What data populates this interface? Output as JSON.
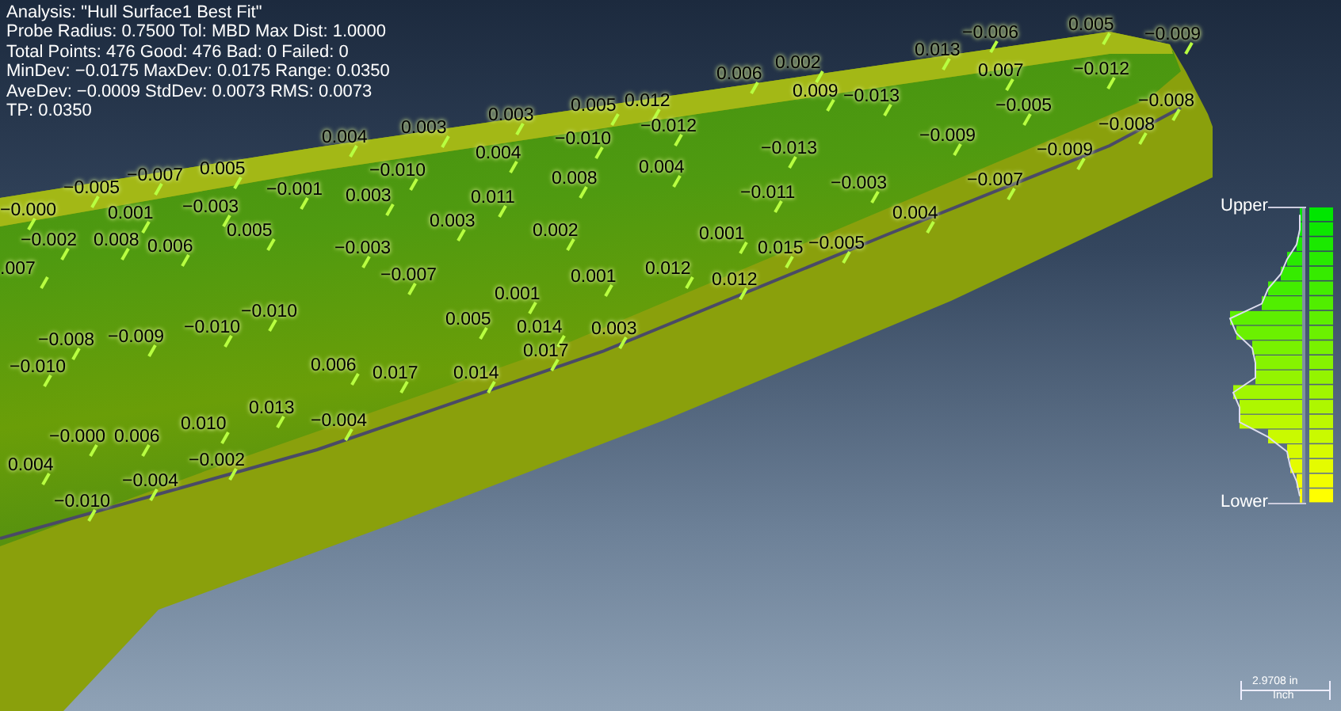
{
  "info_lines": [
    "Analysis: \"Hull Surface1 Best Fit\"",
    "Probe Radius: 0.7500 Tol: MBD Max Dist: 1.0000",
    "Total Points: 476 Good: 476 Bad: 0 Failed: 0",
    "MinDev: −0.0175 MaxDev: 0.0175 Range: 0.0350",
    "AveDev: −0.0009 StdDev: 0.0073 RMS: 0.0073",
    "TP: 0.0350"
  ],
  "deviation_labels": [
    {
      "text": "−0.006"
    },
    {
      "text": "0.005"
    },
    {
      "text": "−0.009"
    },
    {
      "text": "0.013"
    },
    {
      "text": "0.006"
    },
    {
      "text": "0.002"
    },
    {
      "text": "0.007"
    },
    {
      "text": "−0.012"
    },
    {
      "text": "0.005"
    },
    {
      "text": "0.012"
    },
    {
      "text": "0.009"
    },
    {
      "text": "−0.013"
    },
    {
      "text": "−0.005"
    },
    {
      "text": "−0.008"
    },
    {
      "text": "0.003"
    },
    {
      "text": "0.003"
    },
    {
      "text": "−0.012"
    },
    {
      "text": "−0.008"
    },
    {
      "text": "0.004"
    },
    {
      "text": "0.004"
    },
    {
      "text": "−0.010"
    },
    {
      "text": "−0.013"
    },
    {
      "text": "−0.009"
    },
    {
      "text": "−0.009"
    },
    {
      "text": "−0.007"
    },
    {
      "text": "0.005"
    },
    {
      "text": "−0.010"
    },
    {
      "text": "0.008"
    },
    {
      "text": "0.004"
    },
    {
      "text": "−0.007"
    },
    {
      "text": "−0.005"
    },
    {
      "text": "−0.001"
    },
    {
      "text": "0.003"
    },
    {
      "text": "0.011"
    },
    {
      "text": "−0.011"
    },
    {
      "text": "−0.003"
    },
    {
      "text": "−0.000"
    },
    {
      "text": "0.001"
    },
    {
      "text": "−0.003"
    },
    {
      "text": "0.003"
    },
    {
      "text": "0.004"
    },
    {
      "text": "−0.002"
    },
    {
      "text": "0.008"
    },
    {
      "text": "0.006"
    },
    {
      "text": "0.005"
    },
    {
      "text": "−0.003"
    },
    {
      "text": "0.002"
    },
    {
      "text": "0.001"
    },
    {
      "text": "0.015"
    },
    {
      "text": "−0.005"
    },
    {
      "text": ".007"
    },
    {
      "text": "−0.007"
    },
    {
      "text": "0.001"
    },
    {
      "text": "0.012"
    },
    {
      "text": "0.012"
    },
    {
      "text": "0.001"
    },
    {
      "text": "−0.010"
    },
    {
      "text": "−0.010"
    },
    {
      "text": "0.005"
    },
    {
      "text": "0.014"
    },
    {
      "text": "0.003"
    },
    {
      "text": "−0.008"
    },
    {
      "text": "−0.009"
    },
    {
      "text": "0.017"
    },
    {
      "text": "−0.010"
    },
    {
      "text": "0.006"
    },
    {
      "text": "0.017"
    },
    {
      "text": "0.014"
    },
    {
      "text": "0.010"
    },
    {
      "text": "0.013"
    },
    {
      "text": "−0.004"
    },
    {
      "text": "−0.000"
    },
    {
      "text": "0.006"
    },
    {
      "text": "0.004"
    },
    {
      "text": "−0.002"
    },
    {
      "text": "−0.004"
    },
    {
      "text": "−0.010"
    }
  ],
  "legend": {
    "upper_label": "Upper",
    "lower_label": "Lower"
  },
  "scale_bar": {
    "value": "2.9708 in",
    "unit": "Inch"
  }
}
